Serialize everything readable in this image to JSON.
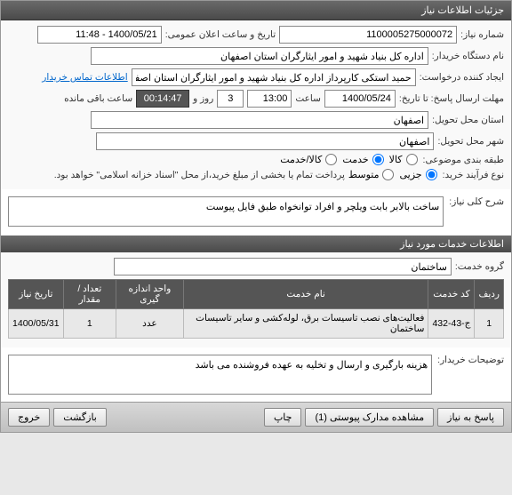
{
  "title_bar": "جزئیات اطلاعات نیاز",
  "fields": {
    "need_number_label": "شماره نیاز:",
    "need_number": "1100005275000072",
    "announce_label": "تاریخ و ساعت اعلان عمومی:",
    "announce_value": "1400/05/21 - 11:48",
    "buyer_label": "نام دستگاه خریدار:",
    "buyer_value": "اداره کل بنیاد شهید و امور ایثارگران استان اصفهان",
    "requester_label": "ایجاد کننده درخواست:",
    "requester_value": "حمید استکی کارپرداز اداره کل بنیاد شهید و امور ایثارگران استان اصفهان",
    "contact_link": "اطلاعات تماس خریدار",
    "deadline_label": "مهلت ارسال پاسخ: تا تاریخ:",
    "deadline_date": "1400/05/24",
    "hour_label": "ساعت",
    "deadline_hour": "13:00",
    "day_label": "روز و",
    "days": "3",
    "countdown": "00:14:47",
    "remaining_label": "ساعت باقی مانده",
    "province_label": "استان محل تحویل:",
    "province": "اصفهان",
    "city_label": "شهر محل تحویل:",
    "city": "اصفهان",
    "category_label": "طبقه بندی موضوعی:",
    "cat_goods": "کالا",
    "cat_service": "خدمت",
    "cat_both": "کالا/خدمت",
    "process_label": "نوع فرآیند خرید: ",
    "proc_small": "جزیی",
    "proc_medium": "متوسط",
    "payment_note": "پرداخت تمام یا بخشی از مبلغ خرید،از محل \"اسناد خزانه اسلامی\" خواهد بود."
  },
  "desc": {
    "label": "شرح کلی نیاز:",
    "value": "ساخت بالابر بابت ویلچر و افراد توانخواه طبق فایل پیوست"
  },
  "section_services": "اطلاعات خدمات مورد نیاز",
  "group": {
    "label": "گروه خدمت:",
    "value": "ساختمان"
  },
  "table": {
    "headers": [
      "ردیف",
      "کد خدمت",
      "نام خدمت",
      "واحد اندازه گیری",
      "تعداد / مقدار",
      "تاریخ نیاز"
    ],
    "rows": [
      [
        "1",
        "ج-43-432",
        "فعالیت‌های نصب تاسیسات برق، لوله‌کشی و سایر تاسیسات ساختمان",
        "عدد",
        "1",
        "1400/05/31"
      ]
    ]
  },
  "buyer_notes": {
    "label": "توضیحات خریدار:",
    "value": "هزینه بارگیری و ارسال و تخلیه به عهده فروشنده می باشد"
  },
  "buttons": {
    "reply": "پاسخ به نیاز",
    "attachments": "مشاهده مدارک پیوستی (1)",
    "print": "چاپ",
    "back": "بازگشت",
    "exit": "خروج"
  }
}
